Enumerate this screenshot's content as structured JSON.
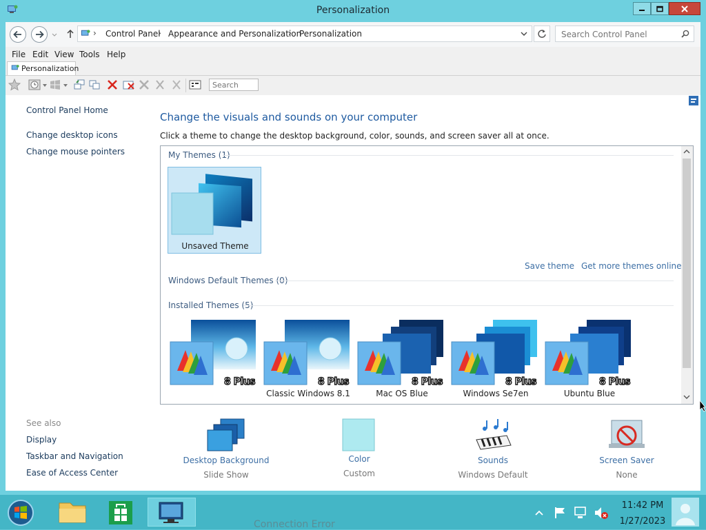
{
  "window": {
    "title": "Personalization"
  },
  "address": {
    "crumbs": [
      "Control Panel",
      "Appearance and Personalization",
      "Personalization"
    ],
    "search_placeholder": "Search Control Panel"
  },
  "menu": [
    "File",
    "Edit",
    "View",
    "Tools",
    "Help"
  ],
  "tab": {
    "label": "Personalization"
  },
  "toolbar": {
    "search_placeholder": "Search"
  },
  "left_nav": {
    "home": "Control Panel Home",
    "links": [
      "Change desktop icons",
      "Change mouse pointers"
    ],
    "see_also_label": "See also",
    "see_also": [
      "Display",
      "Taskbar and Navigation",
      "Ease of Access Center"
    ]
  },
  "main": {
    "heading": "Change the visuals and sounds on your computer",
    "subheading": "Click a theme to change the desktop background, color, sounds, and screen saver all at once.",
    "my_themes_label": "My Themes (1)",
    "unsaved_theme": "Unsaved Theme",
    "save_theme": "Save theme",
    "get_more": "Get more themes online",
    "default_themes_label": "Windows Default Themes (0)",
    "installed_themes_label": "Installed Themes (5)",
    "installed_themes": [
      {
        "name": "",
        "badge": "8 Plus"
      },
      {
        "name": "Classic Windows 8.1",
        "badge": "8 Plus"
      },
      {
        "name": "Mac OS Blue",
        "badge": "8 Plus"
      },
      {
        "name": "Windows Se7en",
        "badge": "8 Plus"
      },
      {
        "name": "Ubuntu Blue",
        "badge": "8 Plus"
      }
    ]
  },
  "bottom": {
    "desktop_background": {
      "label": "Desktop Background",
      "value": "Slide Show"
    },
    "color": {
      "label": "Color",
      "value": "Custom"
    },
    "sounds": {
      "label": "Sounds",
      "value": "Windows Default"
    },
    "screen_saver": {
      "label": "Screen Saver",
      "value": "None"
    }
  },
  "taskbar": {
    "time": "11:42 PM",
    "date": "1/27/2023",
    "connection_error": "Connection Error"
  },
  "colors": {
    "link": "#3d6fa5",
    "heading": "#1e5aa0",
    "window_frame": "#6ed0df",
    "taskbar": "#44b6c6"
  }
}
